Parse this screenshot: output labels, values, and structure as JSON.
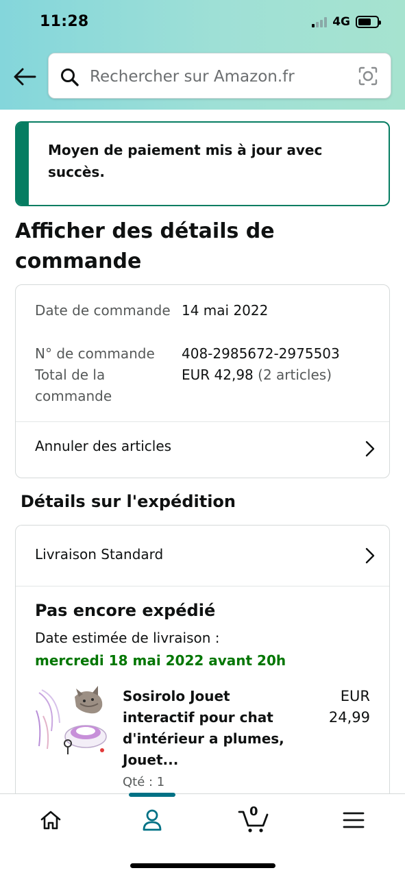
{
  "status_bar": {
    "time": "11:28",
    "network": "4G"
  },
  "search": {
    "placeholder": "Rechercher sur Amazon.fr"
  },
  "alert": {
    "message": "Moyen de paiement mis à jour avec succès.",
    "accent_color": "#067d62"
  },
  "page_title": "Afficher des détails de commande",
  "order": {
    "rows": [
      {
        "label": "Date de commande",
        "value": "14 mai 2022"
      },
      {
        "label": "N° de commande",
        "value": "408-2985672-2975503"
      },
      {
        "label": "Total de la commande",
        "value": "EUR 42,98",
        "extra": "(2 articles)"
      }
    ],
    "cancel_label": "Annuler des articles"
  },
  "shipping": {
    "section_title": "Détails sur l'expédition",
    "method": "Livraison Standard",
    "status": "Pas encore expédié",
    "eta_label": "Date estimée de livraison :",
    "eta_date": "mercredi 18 mai 2022 avant 20h",
    "eta_color": "#007600"
  },
  "product": {
    "title": "Sosirolo Jouet interactif pour chat d'intérieur a plumes, Jouet...",
    "qty": "Qté : 1",
    "price": "EUR 24,99"
  },
  "nav": {
    "cart_count": "0",
    "active": "account",
    "accent_color": "#007185"
  }
}
